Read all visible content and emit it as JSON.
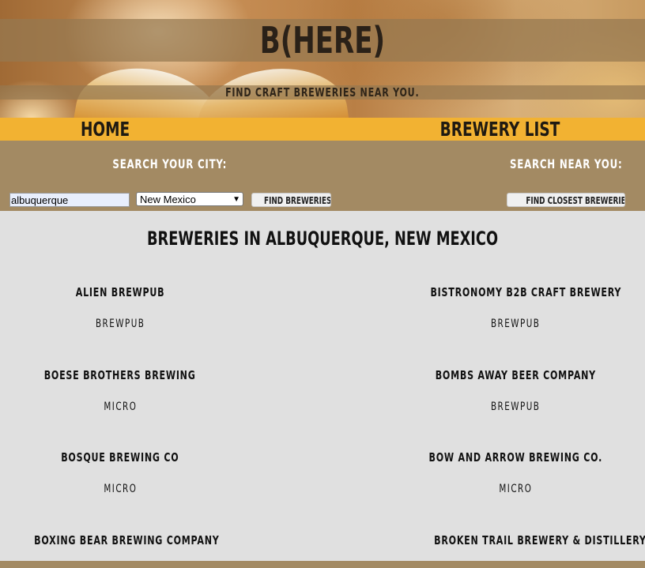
{
  "header": {
    "logo": "B(HERE)",
    "tagline": "FIND CRAFT BREWERIES NEAR YOU."
  },
  "nav": {
    "home": "HOME",
    "brewery_list": "BREWERY LIST"
  },
  "search": {
    "city_label": "SEARCH YOUR CITY:",
    "near_label": "SEARCH NEAR YOU:",
    "city_value": "albuquerque",
    "state_selected": "New Mexico",
    "find_button": "FIND BREWERIES",
    "closest_button": "FIND CLOSEST BREWERIES"
  },
  "results": {
    "title": "BREWERIES IN ALBUQUERQUE, NEW MEXICO",
    "breweries": [
      {
        "name": "ALIEN BREWPUB",
        "type": "BREWPUB"
      },
      {
        "name": "BISTRONOMY B2B CRAFT BREWERY",
        "type": "BREWPUB"
      },
      {
        "name": "BOESE BROTHERS BREWING",
        "type": "MICRO"
      },
      {
        "name": "BOMBS AWAY BEER COMPANY",
        "type": "BREWPUB"
      },
      {
        "name": "BOSQUE BREWING CO",
        "type": "MICRO"
      },
      {
        "name": "BOW AND ARROW BREWING CO.",
        "type": "MICRO"
      },
      {
        "name": "BOXING BEAR BREWING COMPANY",
        "type": ""
      },
      {
        "name": "BROKEN TRAIL BREWERY & DISTILLERY",
        "type": ""
      }
    ]
  }
}
